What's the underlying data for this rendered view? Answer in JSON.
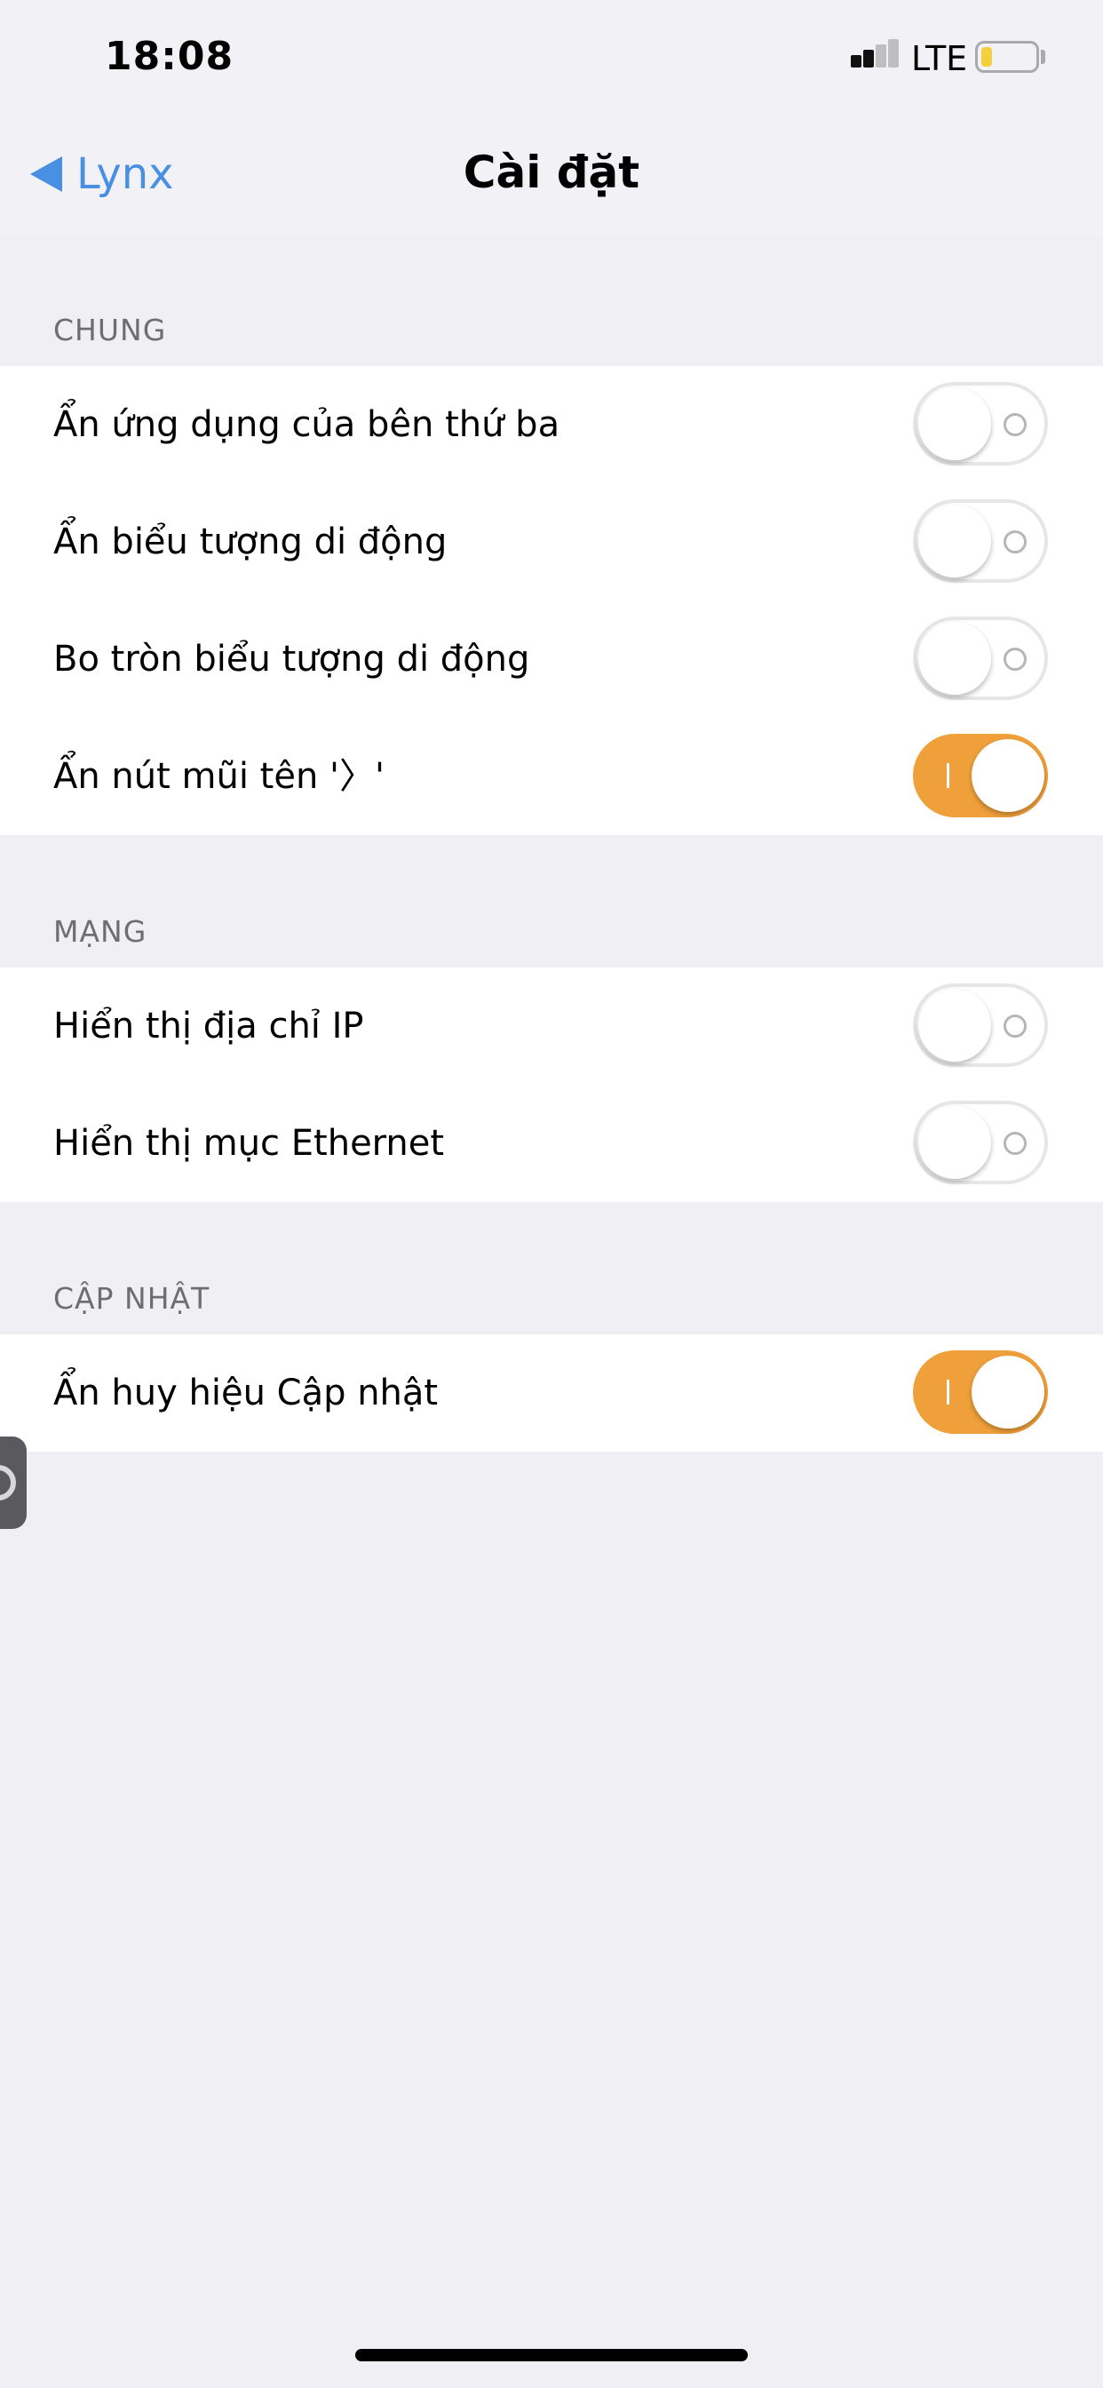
{
  "status_bar": {
    "time": "18:08",
    "carrier": "LTE",
    "signal_icon": "cellular-signal-icon",
    "battery_icon": "battery-low-icon",
    "battery_color": "#f6cf3d"
  },
  "nav": {
    "back_label": "Lynx",
    "back_icon": "back-arrow-icon",
    "title": "Cài đặt"
  },
  "accent_color": "#f0a03a",
  "link_color": "#4a90e2",
  "sections": [
    {
      "header": "CHUNG",
      "rows": [
        {
          "label": "Ẩn ứng dụng của bên thứ ba",
          "on": false
        },
        {
          "label": "Ẩn biểu tượng di động",
          "on": false
        },
        {
          "label": "Bo tròn biểu tượng di động",
          "on": false
        },
        {
          "label": "Ẩn nút mũi tên '〉'",
          "on": true
        }
      ]
    },
    {
      "header": "MẠNG",
      "rows": [
        {
          "label": "Hiển thị địa chỉ IP",
          "on": false
        },
        {
          "label": "Hiển thị mục Ethernet",
          "on": false
        }
      ]
    },
    {
      "header": "CẬP NHẬT",
      "rows": [
        {
          "label": "Ẩn huy hiệu Cập nhật",
          "on": true
        }
      ]
    }
  ]
}
